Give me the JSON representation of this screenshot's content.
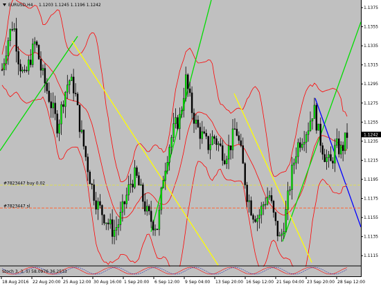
{
  "chart_header": {
    "symbol_tf": "EURUSD,H4",
    "ohlc": "1.1203 1.1245 1.1196 1.1242"
  },
  "price_axis": {
    "labels": [
      "1.1375",
      "1.1355",
      "1.1335",
      "1.1315",
      "1.1295",
      "1.1275",
      "1.1255",
      "1.1235",
      "1.1215",
      "1.1195",
      "1.1175",
      "1.1155",
      "1.1135",
      "1.1115"
    ],
    "current_price": "1.1242"
  },
  "time_axis": {
    "labels": [
      "18 Aug 2016",
      "22 Aug 20:00",
      "25 Aug 12:00",
      "30 Aug 16:00",
      "1 Sep 20:00",
      "6 Sep 12:00",
      "9 Sep 04:00",
      "13 Sep 20:00",
      "16 Sep 12:00",
      "21 Sep 04:00",
      "23 Sep 20:00",
      "28 Sep 12:00"
    ]
  },
  "orders": [
    {
      "label": "#7823447 buy 0.02",
      "price": 1.1189
    },
    {
      "label": "#7823447 sl",
      "price": 1.1165
    }
  ],
  "indicator_panel": {
    "label": "Stoch 3, 3, 5) 58.0976 36.2533"
  },
  "colors": {
    "background": "#c0c0c0",
    "candle": "#000000",
    "trend_up": "#00dd00",
    "trend_down": "#ffff00",
    "channel_down": "#0000ff",
    "bollinger": "#ff0000",
    "buy_line": "#dddd55",
    "sl_line": "#ff6633"
  },
  "chart_data": {
    "type": "candlestick",
    "symbol": "EURUSD",
    "timeframe": "H4",
    "ylim": [
      1.1105,
      1.1383
    ],
    "y_ticks": [
      1.1375,
      1.1355,
      1.1335,
      1.1315,
      1.1295,
      1.1275,
      1.1255,
      1.1235,
      1.1215,
      1.1195,
      1.1175,
      1.1155,
      1.1135,
      1.1115
    ],
    "x_labels": [
      "18 Aug 2016",
      "22 Aug 20:00",
      "25 Aug 12:00",
      "30 Aug 16:00",
      "1 Sep 20:00",
      "6 Sep 12:00",
      "9 Sep 04:00",
      "13 Sep 20:00",
      "16 Sep 12:00",
      "21 Sep 04:00",
      "23 Sep 20:00",
      "28 Sep 12:00"
    ],
    "close_path": [
      1.131,
      1.134,
      1.136,
      1.132,
      1.13,
      1.132,
      1.134,
      1.131,
      1.129,
      1.127,
      1.125,
      1.128,
      1.13,
      1.129,
      1.125,
      1.122,
      1.119,
      1.117,
      1.116,
      1.115,
      1.114,
      1.115,
      1.117,
      1.119,
      1.12,
      1.118,
      1.116,
      1.115,
      1.1145,
      1.12,
      1.123,
      1.125,
      1.126,
      1.13,
      1.127,
      1.125,
      1.124,
      1.123,
      1.124,
      1.123,
      1.122,
      1.123,
      1.125,
      1.122,
      1.118,
      1.116,
      1.1155,
      1.117,
      1.118,
      1.115,
      1.113,
      1.116,
      1.12,
      1.123,
      1.124,
      1.125,
      1.127,
      1.124,
      1.122,
      1.121,
      1.123,
      1.1225,
      1.1242
    ],
    "current_price": 1.1242,
    "grid": false
  }
}
